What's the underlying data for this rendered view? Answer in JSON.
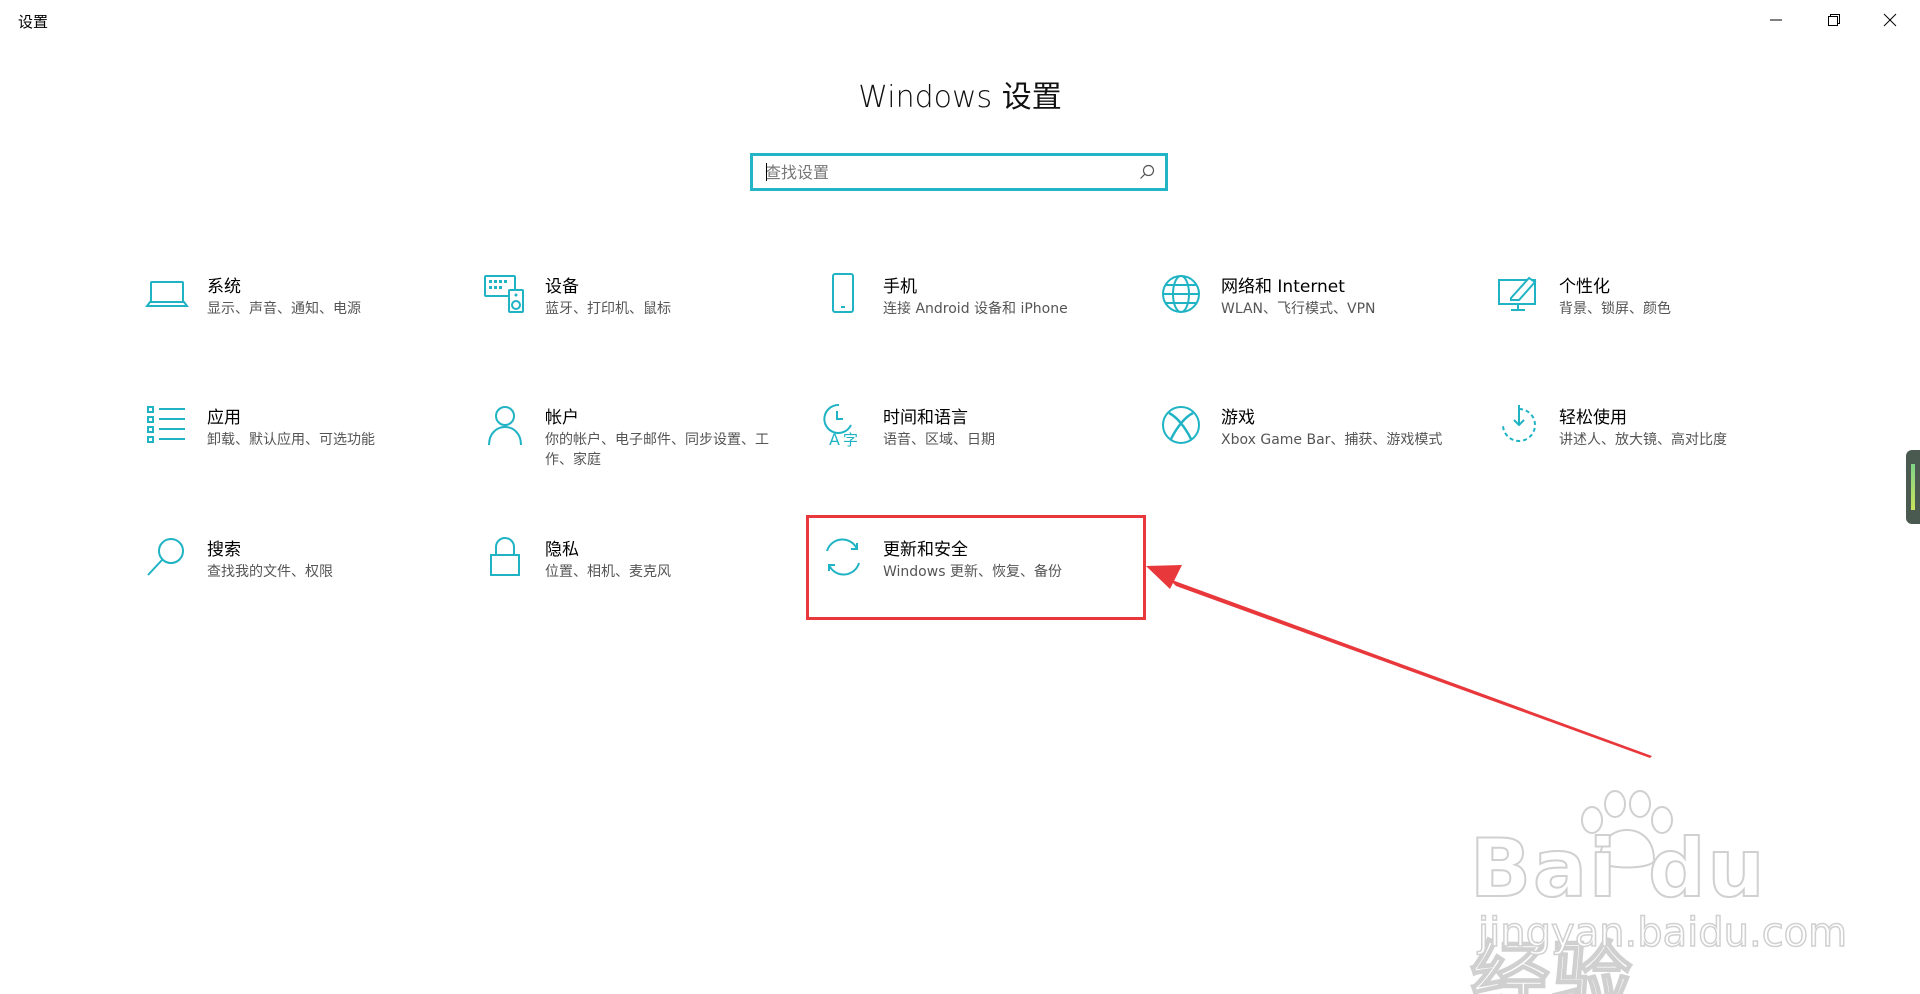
{
  "window": {
    "title": "设置"
  },
  "header": {
    "title": "Windows 设置"
  },
  "search": {
    "placeholder": "查找设置",
    "value": ""
  },
  "tiles": [
    {
      "label": "系统",
      "desc": "显示、声音、通知、电源",
      "icon": "laptop-icon"
    },
    {
      "label": "设备",
      "desc": "蓝牙、打印机、鼠标",
      "icon": "keyboard-speaker-icon"
    },
    {
      "label": "手机",
      "desc": "连接 Android 设备和 iPhone",
      "icon": "phone-icon"
    },
    {
      "label": "网络和 Internet",
      "desc": "WLAN、飞行模式、VPN",
      "icon": "globe-icon"
    },
    {
      "label": "个性化",
      "desc": "背景、锁屏、颜色",
      "icon": "paint-pen-icon"
    },
    {
      "label": "应用",
      "desc": "卸载、默认应用、可选功能",
      "icon": "app-list-icon"
    },
    {
      "label": "帐户",
      "desc": "你的帐户、电子邮件、同步设置、工作、家庭",
      "icon": "person-icon"
    },
    {
      "label": "时间和语言",
      "desc": "语音、区域、日期",
      "icon": "time-language-icon"
    },
    {
      "label": "游戏",
      "desc": "Xbox Game Bar、捕获、游戏模式",
      "icon": "xbox-icon"
    },
    {
      "label": "轻松使用",
      "desc": "讲述人、放大镜、高对比度",
      "icon": "ease-of-access-icon"
    },
    {
      "label": "搜索",
      "desc": "查找我的文件、权限",
      "icon": "search-magnifier-icon"
    },
    {
      "label": "隐私",
      "desc": "位置、相机、麦克风",
      "icon": "lock-icon"
    },
    {
      "label": "更新和安全",
      "desc": "Windows 更新、恢复、备份",
      "icon": "sync-arrows-icon"
    }
  ],
  "watermark": {
    "brand": "Bai du 经验",
    "url": "jingyan.baidu.com"
  },
  "colors": {
    "accent": "#23b5c6",
    "annotation": "#e8383b"
  }
}
